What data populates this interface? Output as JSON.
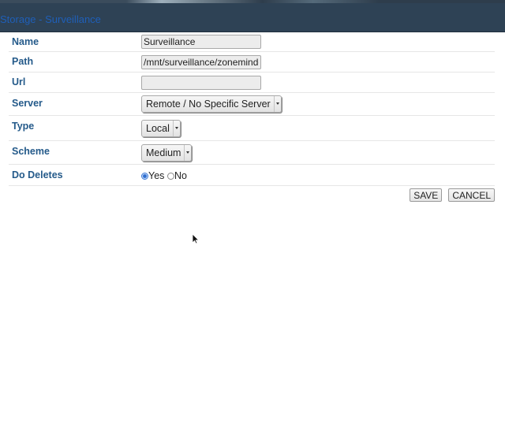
{
  "window": {
    "title": "Storage - Surveillance"
  },
  "form": {
    "name": {
      "label": "Name",
      "value": "Surveillance"
    },
    "path": {
      "label": "Path",
      "value": "/mnt/surveillance/zoneminder"
    },
    "url": {
      "label": "Url",
      "value": ""
    },
    "server": {
      "label": "Server",
      "selected": "Remote / No Specific Server"
    },
    "type": {
      "label": "Type",
      "selected": "Local"
    },
    "scheme": {
      "label": "Scheme",
      "selected": "Medium"
    },
    "do_deletes": {
      "label": "Do Deletes",
      "options": [
        "Yes",
        "No"
      ],
      "selected": "Yes"
    }
  },
  "buttons": {
    "save": "SAVE",
    "cancel": "CANCEL"
  },
  "colors": {
    "title_bar": "#2e4255",
    "title_text": "#1f5fb8",
    "label_text": "#245a8a"
  },
  "icons": {
    "pointer": "mouse-cursor-icon"
  }
}
